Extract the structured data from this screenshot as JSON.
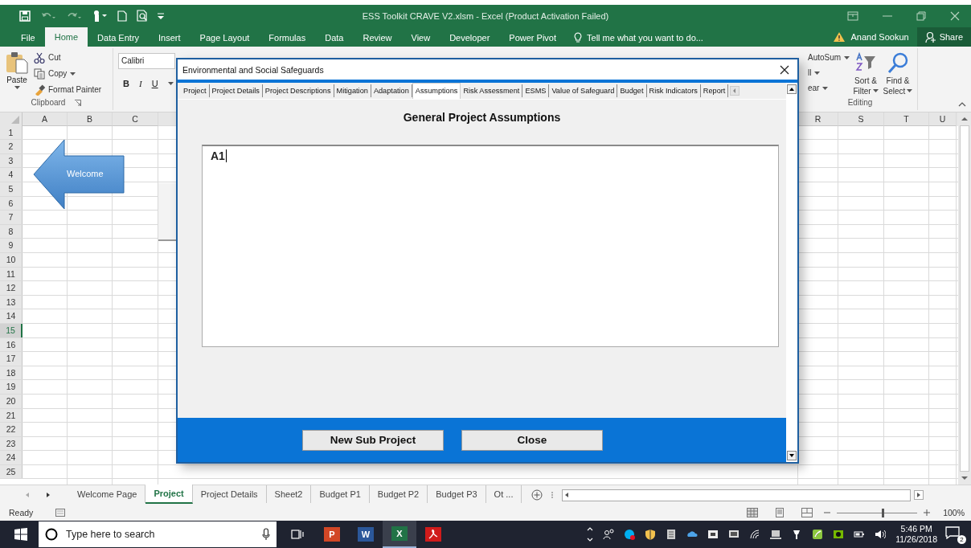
{
  "title_bar": {
    "title": "ESS Toolkit CRAVE V2.xlsm - Excel (Product Activation Failed)"
  },
  "ribbon_tabs": [
    {
      "label": "File",
      "selected": false
    },
    {
      "label": "Home",
      "selected": true
    },
    {
      "label": "Data Entry",
      "selected": false
    },
    {
      "label": "Insert",
      "selected": false
    },
    {
      "label": "Page Layout",
      "selected": false
    },
    {
      "label": "Formulas",
      "selected": false
    },
    {
      "label": "Data",
      "selected": false
    },
    {
      "label": "Review",
      "selected": false
    },
    {
      "label": "View",
      "selected": false
    },
    {
      "label": "Developer",
      "selected": false
    },
    {
      "label": "Power Pivot",
      "selected": false
    }
  ],
  "tell_me": {
    "placeholder": "Tell me what you want to do..."
  },
  "account": {
    "user": "Anand Sookun",
    "share": "Share"
  },
  "clipboard": {
    "paste": "Paste",
    "cut": "Cut",
    "copy": "Copy",
    "format_painter": "Format Painter",
    "label": "Clipboard"
  },
  "font": {
    "font_name": "Calibri",
    "bold": "B",
    "italic": "I",
    "underline": "U"
  },
  "editing": {
    "autosum": "AutoSum",
    "fill": "ll",
    "clear": "ear",
    "sort_filter": [
      "Sort &",
      "Filter"
    ],
    "find_select": [
      "Find &",
      "Select"
    ],
    "label": "Editing"
  },
  "columns_left": [
    "A",
    "B",
    "C"
  ],
  "columns_right": [
    "R",
    "S",
    "T",
    "U"
  ],
  "rows": [
    {
      "label": "1",
      "selected": false
    },
    {
      "label": "2",
      "selected": false
    },
    {
      "label": "3",
      "selected": false
    },
    {
      "label": "4",
      "selected": false
    },
    {
      "label": "5",
      "selected": false
    },
    {
      "label": "6",
      "selected": false
    },
    {
      "label": "7",
      "selected": false
    },
    {
      "label": "8",
      "selected": false
    },
    {
      "label": "9",
      "selected": false
    },
    {
      "label": "10",
      "selected": false
    },
    {
      "label": "11",
      "selected": false
    },
    {
      "label": "12",
      "selected": false
    },
    {
      "label": "13",
      "selected": false
    },
    {
      "label": "14",
      "selected": false
    },
    {
      "label": "15",
      "selected": true
    },
    {
      "label": "16",
      "selected": false
    },
    {
      "label": "17",
      "selected": false
    },
    {
      "label": "18",
      "selected": false
    },
    {
      "label": "19",
      "selected": false
    },
    {
      "label": "20",
      "selected": false
    },
    {
      "label": "21",
      "selected": false
    },
    {
      "label": "22",
      "selected": false
    },
    {
      "label": "23",
      "selected": false
    },
    {
      "label": "24",
      "selected": false
    },
    {
      "label": "25",
      "selected": false
    }
  ],
  "shape": {
    "label": "Welcome"
  },
  "sheet_tabs": [
    {
      "label": "Welcome Page",
      "selected": false
    },
    {
      "label": "Project",
      "selected": true
    },
    {
      "label": "Project Details",
      "selected": false
    },
    {
      "label": "Sheet2",
      "selected": false
    },
    {
      "label": "Budget P1",
      "selected": false
    },
    {
      "label": "Budget P2",
      "selected": false
    },
    {
      "label": "Budget P3",
      "selected": false
    },
    {
      "label": "Ot ...",
      "selected": false
    }
  ],
  "status_bar": {
    "status": "Ready",
    "zoom": "100%",
    "zoom_slider": {
      "level": 0.57
    }
  },
  "taskbar": {
    "search": {
      "placeholder": "Type here to search"
    },
    "apps": [
      {
        "kind": "powerpoint",
        "letter": "P",
        "selected": false
      },
      {
        "kind": "word",
        "letter": "W",
        "selected": false
      },
      {
        "kind": "excel",
        "letter": "X",
        "selected": true
      },
      {
        "kind": "acrobat",
        "selected": false
      }
    ],
    "time": "5:46 PM",
    "date": "11/26/2018",
    "notifications": "2"
  },
  "dialog": {
    "title": "Environmental and Social Safeguards",
    "tabs": [
      {
        "label": "Project",
        "selected": false
      },
      {
        "label": "Project Details",
        "selected": false
      },
      {
        "label": "Project Descriptions",
        "selected": false
      },
      {
        "label": "Mitigation",
        "selected": false
      },
      {
        "label": "Adaptation",
        "selected": false
      },
      {
        "label": "Assumptions",
        "selected": true
      },
      {
        "label": "Risk Assessment",
        "selected": false
      },
      {
        "label": "ESMS",
        "selected": false
      },
      {
        "label": "Value of Safeguard",
        "selected": false
      },
      {
        "label": "Budget",
        "selected": false
      },
      {
        "label": "Risk Indicators",
        "selected": false
      },
      {
        "label": "Report",
        "selected": false
      }
    ],
    "heading": "General Project Assumptions",
    "text_value": "A1",
    "buttons": [
      "New Sub Project",
      "Close"
    ]
  }
}
